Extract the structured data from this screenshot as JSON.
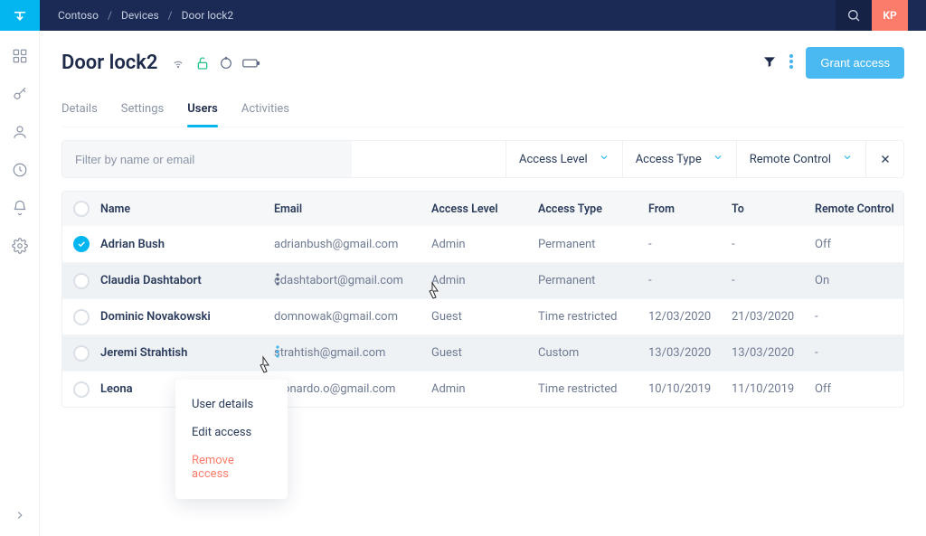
{
  "topbar": {
    "breadcrumbs": [
      "Contoso",
      "Devices",
      "Door lock2"
    ],
    "avatar_initials": "KP"
  },
  "page": {
    "title": "Door lock2",
    "grant_label": "Grant access"
  },
  "tabs": [
    "Details",
    "Settings",
    "Users",
    "Activities"
  ],
  "active_tab": "Users",
  "filters": {
    "search_placeholder": "Filter by name or email",
    "dd_level": "Access Level",
    "dd_type": "Access Type",
    "dd_remote": "Remote Control"
  },
  "columns": {
    "name": "Name",
    "email": "Email",
    "level": "Access Level",
    "type": "Access Type",
    "from": "From",
    "to": "To",
    "remote": "Remote Control"
  },
  "rows": [
    {
      "checked": true,
      "name": "Adrian Bush",
      "email": "adrianbush@gmail.com",
      "level": "Admin",
      "type": "Permanent",
      "from": "-",
      "to": "-",
      "remote": "Off"
    },
    {
      "checked": false,
      "name": "Claudia Dashtabort",
      "email": "cdashtabort@gmail.com",
      "level": "Admin",
      "type": "Permanent",
      "from": "-",
      "to": "-",
      "remote": "On",
      "hover": true,
      "show_more": true
    },
    {
      "checked": false,
      "name": "Dominic Novakowski",
      "email": "domnowak@gmail.com",
      "level": "Guest",
      "type": "Time restricted",
      "from": "12/03/2020",
      "to": "21/03/2020",
      "remote": "-"
    },
    {
      "checked": false,
      "name": "Jeremi Strahtish",
      "email": "strahtish@gmail.com",
      "level": "Guest",
      "type": "Custom",
      "from": "13/03/2020",
      "to": "13/03/2020",
      "remote": "-",
      "hover": true,
      "show_more": true,
      "more_blue": true,
      "menu_open": true
    },
    {
      "checked": false,
      "name": "Leona",
      "email": "leonardo.o@gmail.com",
      "level": "Admin",
      "type": "Time restricted",
      "from": "10/10/2019",
      "to": "11/10/2019",
      "remote": "Off"
    }
  ],
  "context_menu": {
    "user_details": "User details",
    "edit_access": "Edit access",
    "remove_access": "Remove access"
  }
}
